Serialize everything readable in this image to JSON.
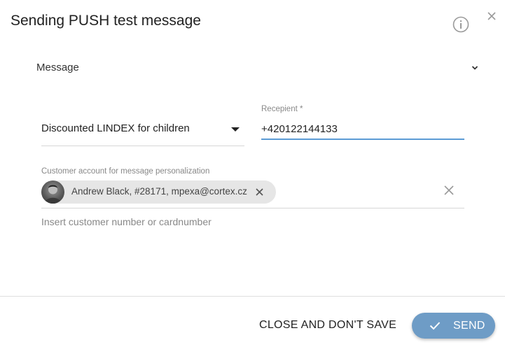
{
  "dialog": {
    "title": "Sending PUSH test message",
    "info_icon": "info-circle-icon",
    "close_icon": "close-icon"
  },
  "section": {
    "label": "Message",
    "icon": "chevron-down-icon"
  },
  "template_select": {
    "value": "Discounted LINDEX for children",
    "icon": "caret-down-icon"
  },
  "recipient": {
    "label": "Recepient *",
    "value": "+420122144133"
  },
  "customer": {
    "label": "Customer account for message personalization",
    "chip_text": "Andrew Black, #28171, mpexa@cortex.cz",
    "search_placeholder": "Insert customer number or cardnumber"
  },
  "footer": {
    "close_label": "CLOSE AND DON'T SAVE",
    "send_label": "SEND"
  },
  "colors": {
    "accent": "#6e9cc6",
    "focus_underline": "#5b9bd5"
  }
}
